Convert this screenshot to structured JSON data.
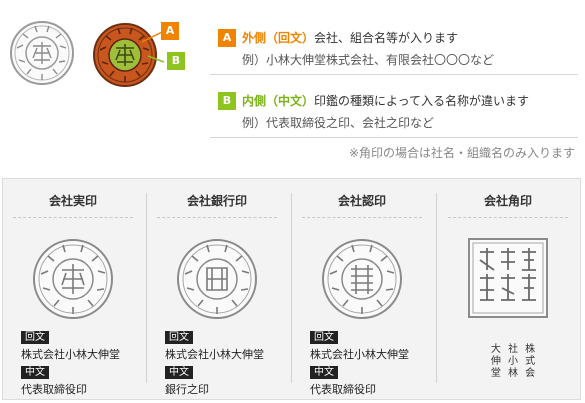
{
  "legend": {
    "a": {
      "marker": "A",
      "keyword": "外側（回文）",
      "text": "会社、組合名等が入ります",
      "example": "例）小林大伸堂株式会社、有限会社〇〇〇など"
    },
    "b": {
      "marker": "B",
      "keyword": "内側（中文）",
      "text": "印鑑の種類によって入る名称が違います",
      "example": "例）代表取締役之印、会社之印など"
    },
    "note": "※角印の場合は社名・組織名のみ入ります"
  },
  "colors": {
    "orange": "#f08300",
    "green": "#8fc31f",
    "seal_orange": "#c8561e"
  },
  "seal_text": {
    "top_photo_outer": "小林大伸堂株式会社",
    "top_photo_inner": "代表取締役之印",
    "jitsuin_inner": "代表取締役印",
    "ginkoin_inner": "銀行之印",
    "ninin_inner": "代表取締役印",
    "kakuin": "株式会社小林大伸堂"
  },
  "cards": [
    {
      "title": "会社実印",
      "outer_tag": "回文",
      "outer_value": "株式会社小林大伸堂",
      "inner_tag": "中文",
      "inner_value": "代表取締役印"
    },
    {
      "title": "会社銀行印",
      "outer_tag": "回文",
      "outer_value": "株式会社小林大伸堂",
      "inner_tag": "中文",
      "inner_value": "銀行之印"
    },
    {
      "title": "会社認印",
      "outer_tag": "回文",
      "outer_value": "株式会社小林大伸堂",
      "inner_tag": "中文",
      "inner_value": "代表取締役印"
    },
    {
      "title": "会社角印",
      "kakuin_text": "大 社 株\n伸 小 式\n堂 林 会"
    }
  ]
}
